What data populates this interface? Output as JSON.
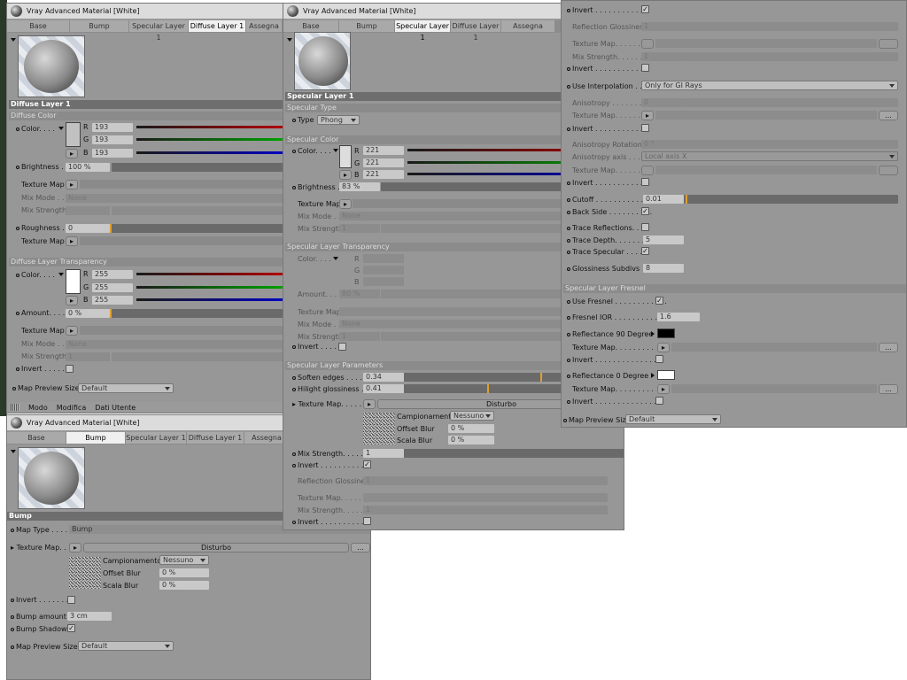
{
  "window_title": "Vray Advanced Material [White]",
  "tabs": [
    "Base",
    "Bump",
    "Specular Layer 1",
    "Diffuse Layer 1",
    "Assegna"
  ],
  "diffuse": {
    "section": "Diffuse Layer 1",
    "color_sub": "Diffuse Color",
    "color_label": "Color. . . .",
    "r": "193",
    "g": "193",
    "b": "193",
    "brightness_label": "Brightness . .",
    "brightness": "100 %",
    "texture_map": "Texture Map",
    "mix_mode": "Mix Mode . .",
    "mix_mode_val": "None",
    "mix_strength": "Mix Strength",
    "roughness_label": "Roughness . .",
    "roughness": "0",
    "transp_sub": "Diffuse Layer Transparency",
    "tr": "255",
    "tg": "255",
    "tb": "255",
    "amount_label": "Amount. . . . . .",
    "amount": "0 %",
    "mix_strength_val": "1",
    "invert": "Invert . . . . .",
    "map_preview": "Map Preview Size",
    "map_preview_val": "Default"
  },
  "menu": {
    "items": [
      "Modo",
      "Modifica",
      "Dati Utente"
    ]
  },
  "bump": {
    "section": "Bump",
    "map_type_label": "Map Type . . . . .",
    "map_type": "Bump",
    "texture_map_label": "Texture Map. . . .",
    "shader": "Disturbo",
    "campionamento": "Campionamento",
    "campionamento_val": "Nessuno",
    "offset_blur": "Offset Blur",
    "offset_val": "0 %",
    "scala_blur": "Scala Blur",
    "scala_val": "0 %",
    "invert": "Invert . . . . . . . .",
    "bump_amount": "Bump amount",
    "bump_amount_val": "3 cm",
    "bump_shadows": "Bump Shadows",
    "map_preview": "Map Preview Size",
    "map_preview_val": "Default",
    "more": "..."
  },
  "specular": {
    "section": "Specular Layer 1",
    "type_sub": "Specular Type",
    "type_label": "Type",
    "type_val": "Phong",
    "color_sub": "Specular Color",
    "color_label": "Color. . . .",
    "r": "221",
    "g": "221",
    "b": "221",
    "brightness_label": "Brightness . .",
    "brightness": "83 %",
    "texture_map": "Texture Map",
    "mix_mode": "Mix Mode . .",
    "mix_mode_val": "None",
    "mix_strength": "Mix Strength",
    "mix_strength_val": "1",
    "transp_sub": "Specular Layer Transparency",
    "amount_label": "Amount. . . . .",
    "amount": "80 %",
    "invert": "Invert . . . . .",
    "params_sub": "Specular Layer Parameters",
    "soften_label": "Soften edges . . . . .",
    "soften": "0.34",
    "hilight_label": "Hilight glossiness . .",
    "hilight": "0.41",
    "texmap_label": "Texture Map. . . . . .",
    "shader": "Disturbo",
    "campionamento": "Campionamento",
    "campionamento_val": "Nessuno",
    "offset_blur": "Offset Blur",
    "offset_val": "0 %",
    "scala_blur": "Scala Blur",
    "scala_val": "0 %",
    "mix_label": "Mix Strength. . . . . . .",
    "mix_val": "1",
    "invert2": "Invert . . . . . . . . . . .",
    "refl_gloss": "Reflection Glossiness",
    "refl_val": "1",
    "texmap2": "Texture Map. . . . . . .",
    "mix2": "Mix Strength. . . . . . .",
    "mix2_val": "1",
    "invert3": "Invert . . . . . . . . . . ."
  },
  "right": {
    "invert_top": "Invert . . . . . . . . . . . .",
    "refl_gloss": "Reflection Glossiness",
    "refl_val": "1",
    "texmap": "Texture Map. . . . . . .",
    "mix": "Mix Strength. . . . . . .",
    "mix_val": "1",
    "invert1": "Invert . . . . . . . . . . . .",
    "use_interp": "Use Interpolation . . . .",
    "use_interp_val": "Only for GI Rays",
    "anisotropy": "Anisotropy . . . . . . . .",
    "aniso_val": "0",
    "texmap_a": "Texture Map. . . . . . .",
    "invert2": "Invert . . . . . . . . . . . .",
    "aniso_rot": "Anisotropy Rotation",
    "aniso_rot_val": "0 °",
    "aniso_axis": "Anisotropy axis . . . .",
    "aniso_axis_val": "Local axis X",
    "texmap_b": "Texture Map. . . . . . .",
    "invert3": "Invert . . . . . . . . . . . .",
    "cutoff": "Cutoff . . . . . . . . . . . .",
    "cutoff_val": "0.01",
    "back_side": "Back Side . . . . . . . . . .",
    "trace_refl": "Trace Reflections. . . .",
    "trace_depth": "Trace Depth. . . . . . . .",
    "trace_depth_val": "5",
    "trace_spec": "Trace Specular . . . . .",
    "gloss_subdivs": "Glossiness Subdivs",
    "gloss_val": "8",
    "fresnel_sub": "Specular Layer Fresnel",
    "use_fresnel": "Use Fresnel . . . . . . . . . . . .",
    "fresnel_ior": "Fresnel IOR . . . . . . . . . . .",
    "fresnel_ior_val": "1.6",
    "refl90": "Reflectance 90 Degree",
    "texmap_c": "Texture Map. . . . . . . . .",
    "invert4": "Invert . . . . . . . . . . . . . . .",
    "refl0": "Reflectance  0 Degree",
    "texmap_d": "Texture Map. . . . . . . . .",
    "invert5": "Invert . . . . . . . . . . . . . . .",
    "map_preview": "Map Preview Size",
    "map_preview_val": "Default",
    "more": "..."
  },
  "colors": {
    "red": "#b00000",
    "green": "#00a000",
    "blue": "#0000c0",
    "orange": "#e0a030"
  }
}
